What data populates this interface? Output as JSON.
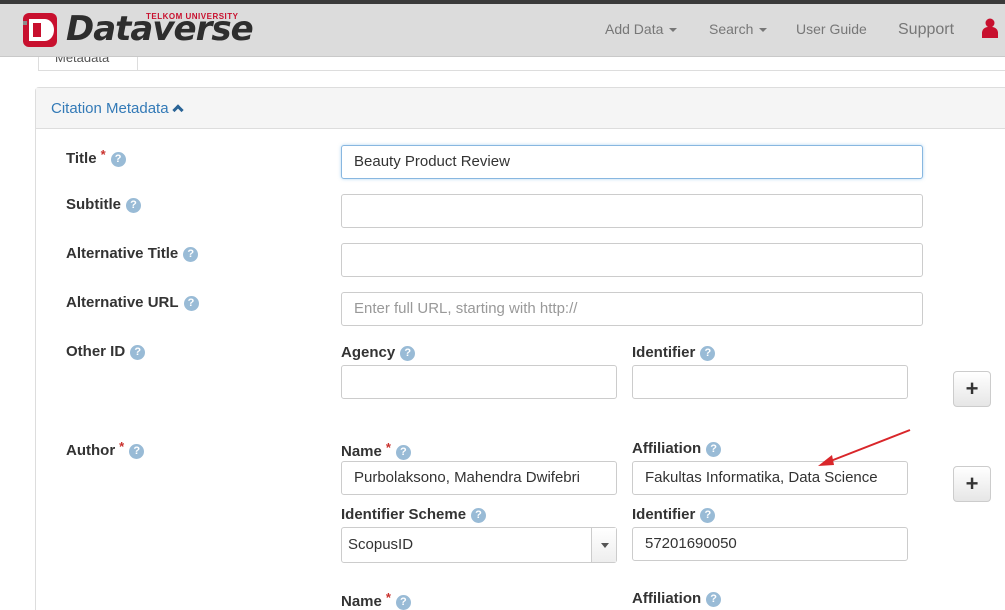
{
  "navbar": {
    "brand": "Dataverse",
    "brand_sub": "TELKOM UNIVERSITY",
    "items": [
      {
        "label": "Add Data"
      },
      {
        "label": "Search"
      },
      {
        "label": "User Guide"
      },
      {
        "label": "Support"
      }
    ]
  },
  "tab": {
    "label": "Metadata"
  },
  "section": {
    "title": "Citation Metadata"
  },
  "fields": {
    "title": {
      "label": "Title",
      "value": "Beauty Product Review"
    },
    "subtitle": {
      "label": "Subtitle",
      "value": ""
    },
    "alt_title": {
      "label": "Alternative Title",
      "value": ""
    },
    "alt_url": {
      "label": "Alternative URL",
      "value": "",
      "placeholder": "Enter full URL, starting with http://"
    },
    "other_id": {
      "label": "Other ID",
      "agency_label": "Agency",
      "identifier_label": "Identifier",
      "agency_value": "",
      "identifier_value": ""
    },
    "author": {
      "label": "Author",
      "name_label": "Name",
      "affiliation_label": "Affiliation",
      "id_scheme_label": "Identifier Scheme",
      "identifier_label": "Identifier",
      "entries": [
        {
          "name": "Purbolaksono, Mahendra Dwifebri",
          "affiliation": "Fakultas Informatika, Data Science",
          "scheme": "ScopusID",
          "identifier": "57201690050"
        }
      ]
    }
  },
  "required_mark": "*",
  "help_glyph": "?",
  "plus_glyph": "+",
  "colors": {
    "link": "#337ab7",
    "required": "#c9302c",
    "help": "#99bbd6",
    "arrow": "#d9262a",
    "brand_red": "#c8102e"
  }
}
